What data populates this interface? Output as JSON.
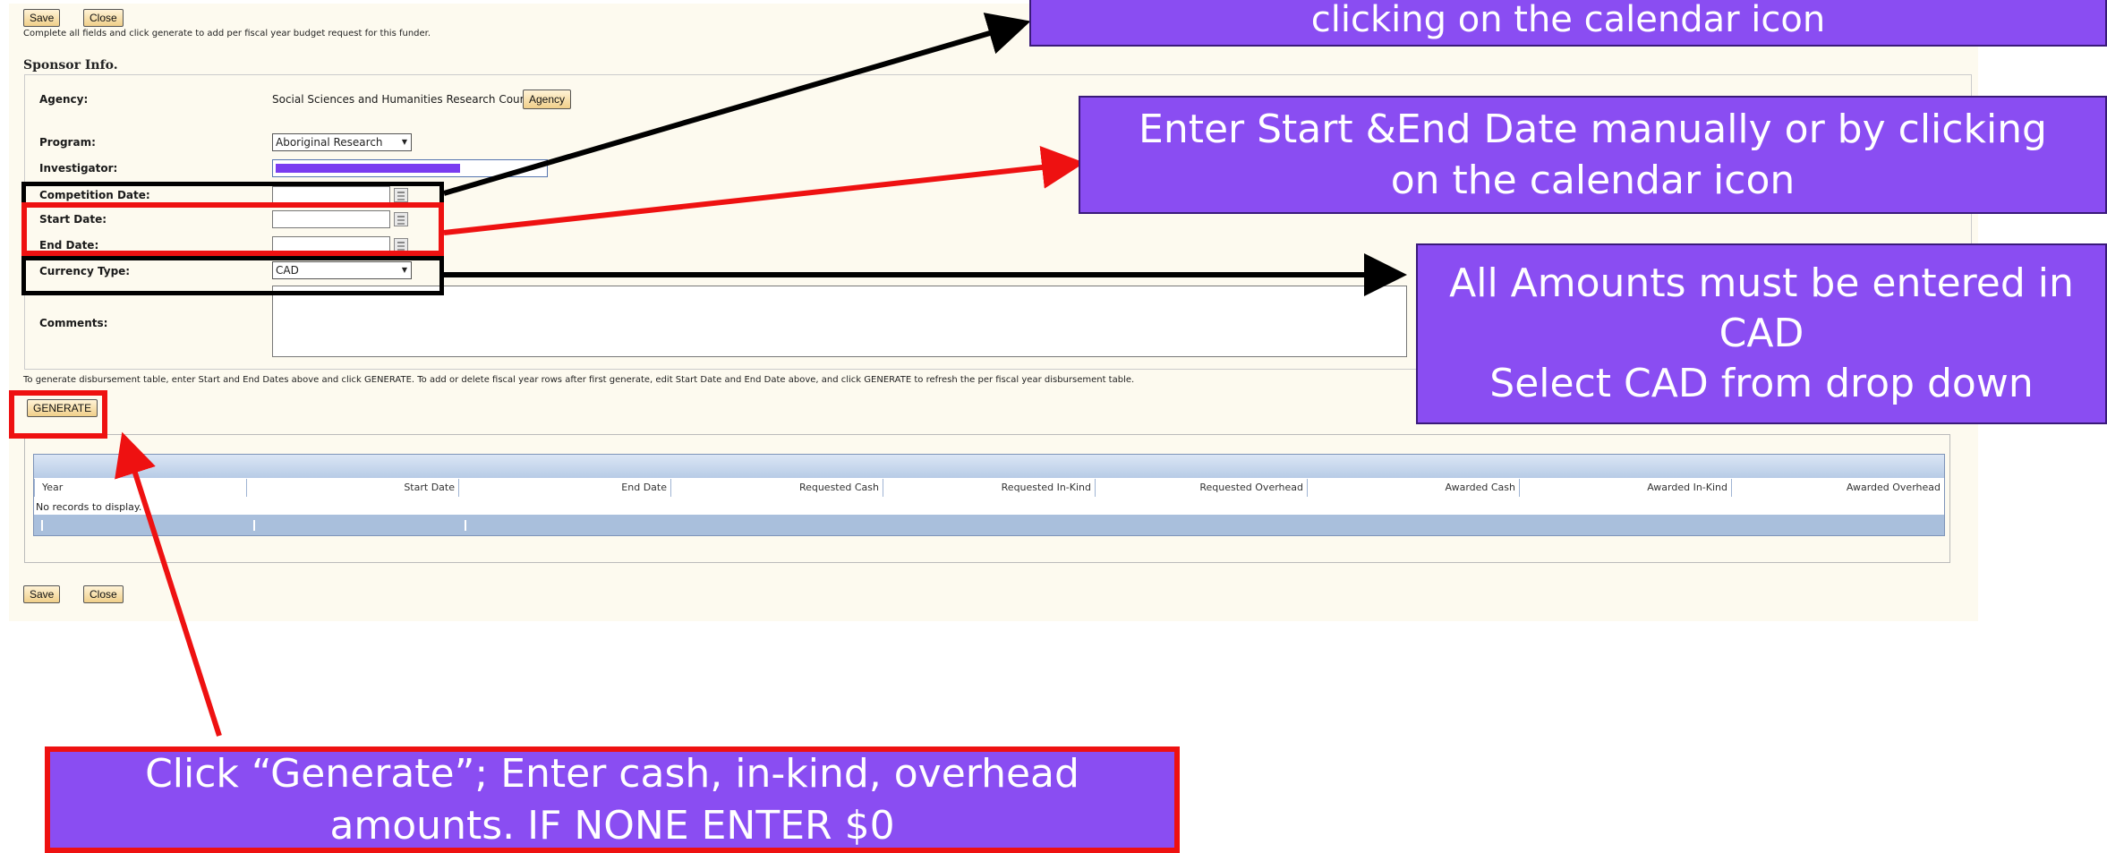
{
  "toolbar": {
    "save_label": "Save",
    "close_label": "Close"
  },
  "instructions": "Complete all fields and click generate to add per fiscal year budget request for this funder.",
  "section_title": "Sponsor Info.",
  "form": {
    "agency_label": "Agency:",
    "agency_value": "Social Sciences and Humanities Research Council",
    "agency_button": "Agency",
    "program_label": "Program:",
    "program_value": "Aboriginal Research",
    "investigator_label": "Investigator:",
    "competition_date_label": "Competition Date:",
    "start_date_label": "Start Date:",
    "end_date_label": "End Date:",
    "currency_label": "Currency Type:",
    "currency_value": "CAD",
    "comments_label": "Comments:"
  },
  "generate_help": "To generate disbursement table, enter Start and End Dates above and click GENERATE. To add or delete fiscal year rows after first generate, edit Start Date and End Date above, and click GENERATE to refresh the per fiscal year disbursement table.",
  "generate_button": "GENERATE",
  "table": {
    "columns": [
      "Year",
      "Start Date",
      "End Date",
      "Requested Cash",
      "Requested In-Kind",
      "Requested Overhead",
      "Awarded Cash",
      "Awarded In-Kind",
      "Awarded Overhead"
    ],
    "empty_text": "No records to display."
  },
  "callouts": {
    "top": "clicking on the calendar icon",
    "dates": "Enter Start &End Date manually or by clicking on the calendar icon",
    "currency_line1": "All Amounts must be entered in",
    "currency_line2": "CAD",
    "currency_line3": "Select CAD from drop down",
    "generate": "Click “Generate”; Enter cash, in-kind, overhead amounts. IF NONE ENTER $0"
  },
  "colors": {
    "callout_bg": "#8a4df2",
    "red": "#ee1111",
    "black": "#000000",
    "table_bar": "#a9bfdc"
  }
}
